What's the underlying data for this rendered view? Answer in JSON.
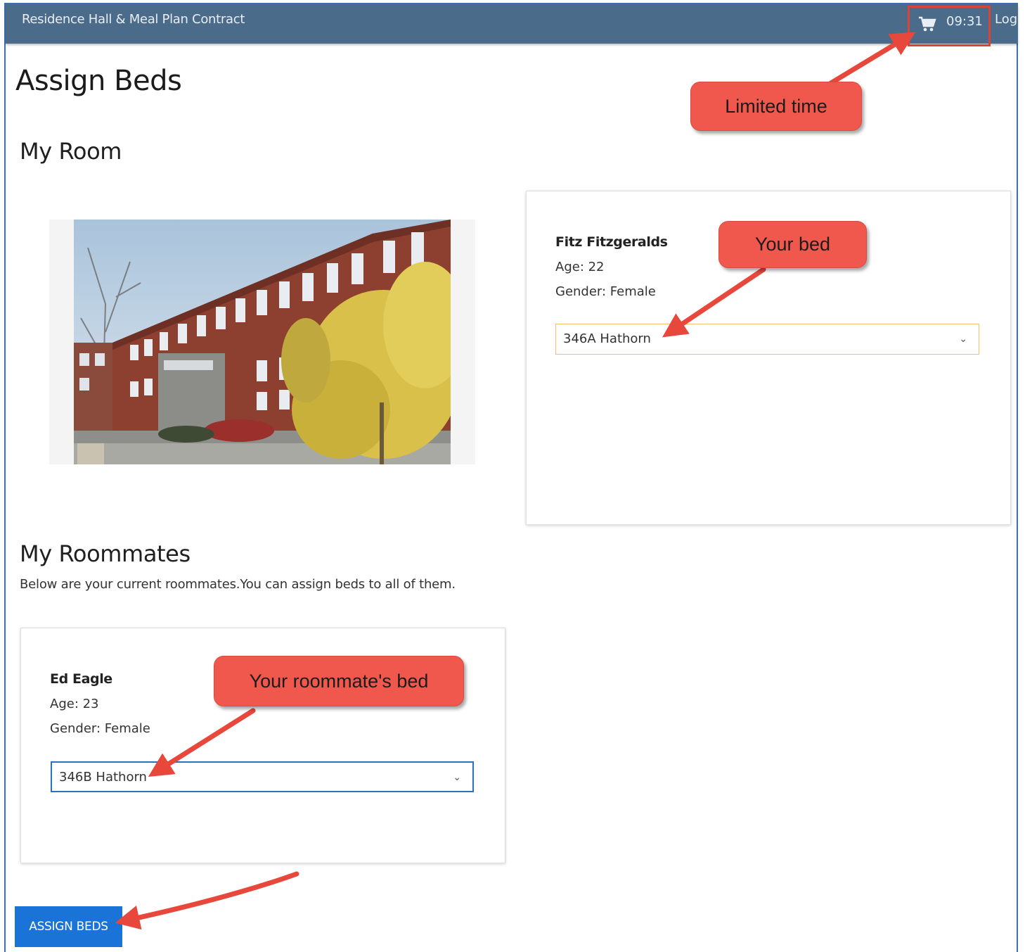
{
  "header": {
    "app_title": "Residence Hall & Meal Plan Contract",
    "cart_icon": "shopping-cart-icon",
    "timer": "09:31",
    "logout_label": "Log"
  },
  "page": {
    "title": "Assign Beds"
  },
  "my_room": {
    "title": "My Room",
    "photo": "residence-hall-building-photo",
    "person": {
      "name": "Fitz Fitzgeralds",
      "age": "Age: 22",
      "gender": "Gender: Female",
      "bed_value": "346A Hathorn"
    }
  },
  "roommates": {
    "title": "My Roommates",
    "description": "Below are your current roommates.You can assign beds to all of them.",
    "items": [
      {
        "name": "Ed Eagle",
        "age": "Age: 23",
        "gender": "Gender: Female",
        "bed_value": "346B Hathorn"
      }
    ]
  },
  "actions": {
    "assign_label": "ASSIGN BEDS"
  },
  "annotations": {
    "limited_time": "Limited time",
    "your_bed": "Your bed",
    "roommate_bed": "Your roommate's bed"
  },
  "colors": {
    "header_bg": "#4a6b8a",
    "callout": "#f0584d",
    "button": "#1a73d6",
    "highlight_border": "#d9443a"
  }
}
